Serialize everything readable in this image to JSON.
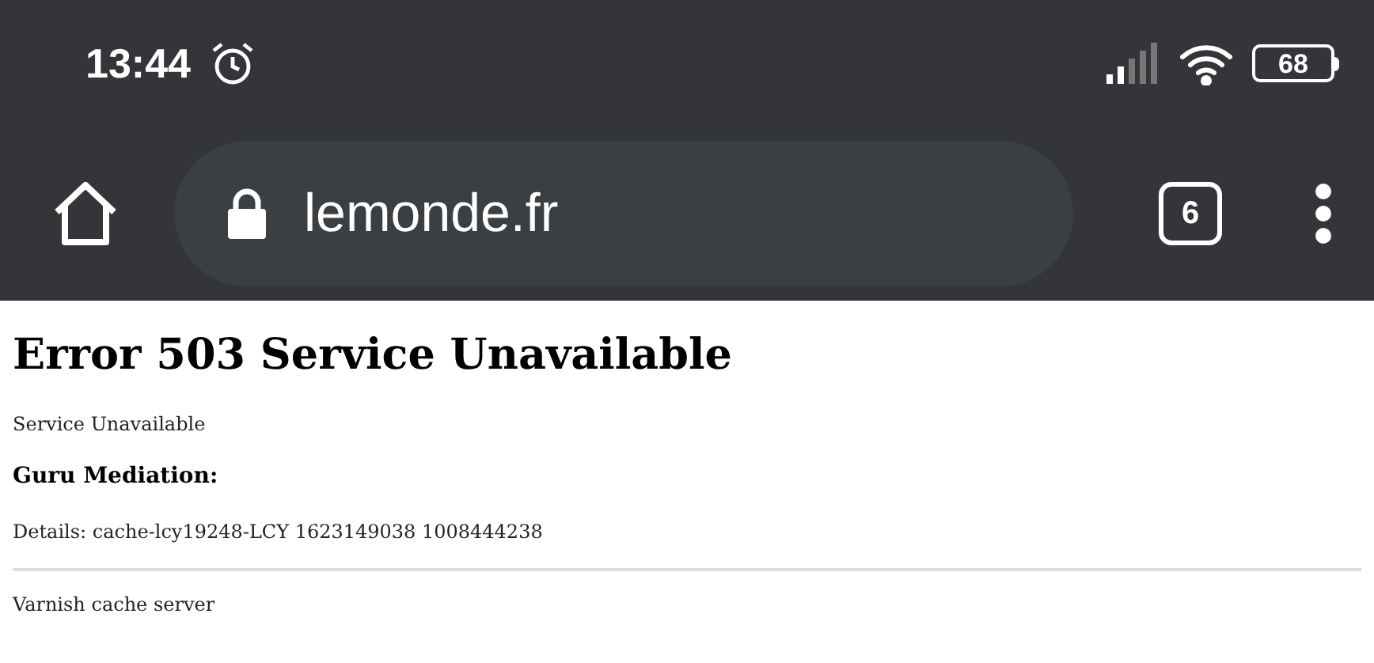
{
  "status_bar": {
    "time": "13:44",
    "battery": "68"
  },
  "toolbar": {
    "url": "lemonde.fr",
    "tab_count": "6"
  },
  "page": {
    "heading": "Error 503 Service Unavailable",
    "message": "Service Unavailable",
    "subheading": "Guru Mediation:",
    "details": "Details: cache-lcy19248-LCY 1623149038 1008444238",
    "footer": "Varnish cache server"
  }
}
